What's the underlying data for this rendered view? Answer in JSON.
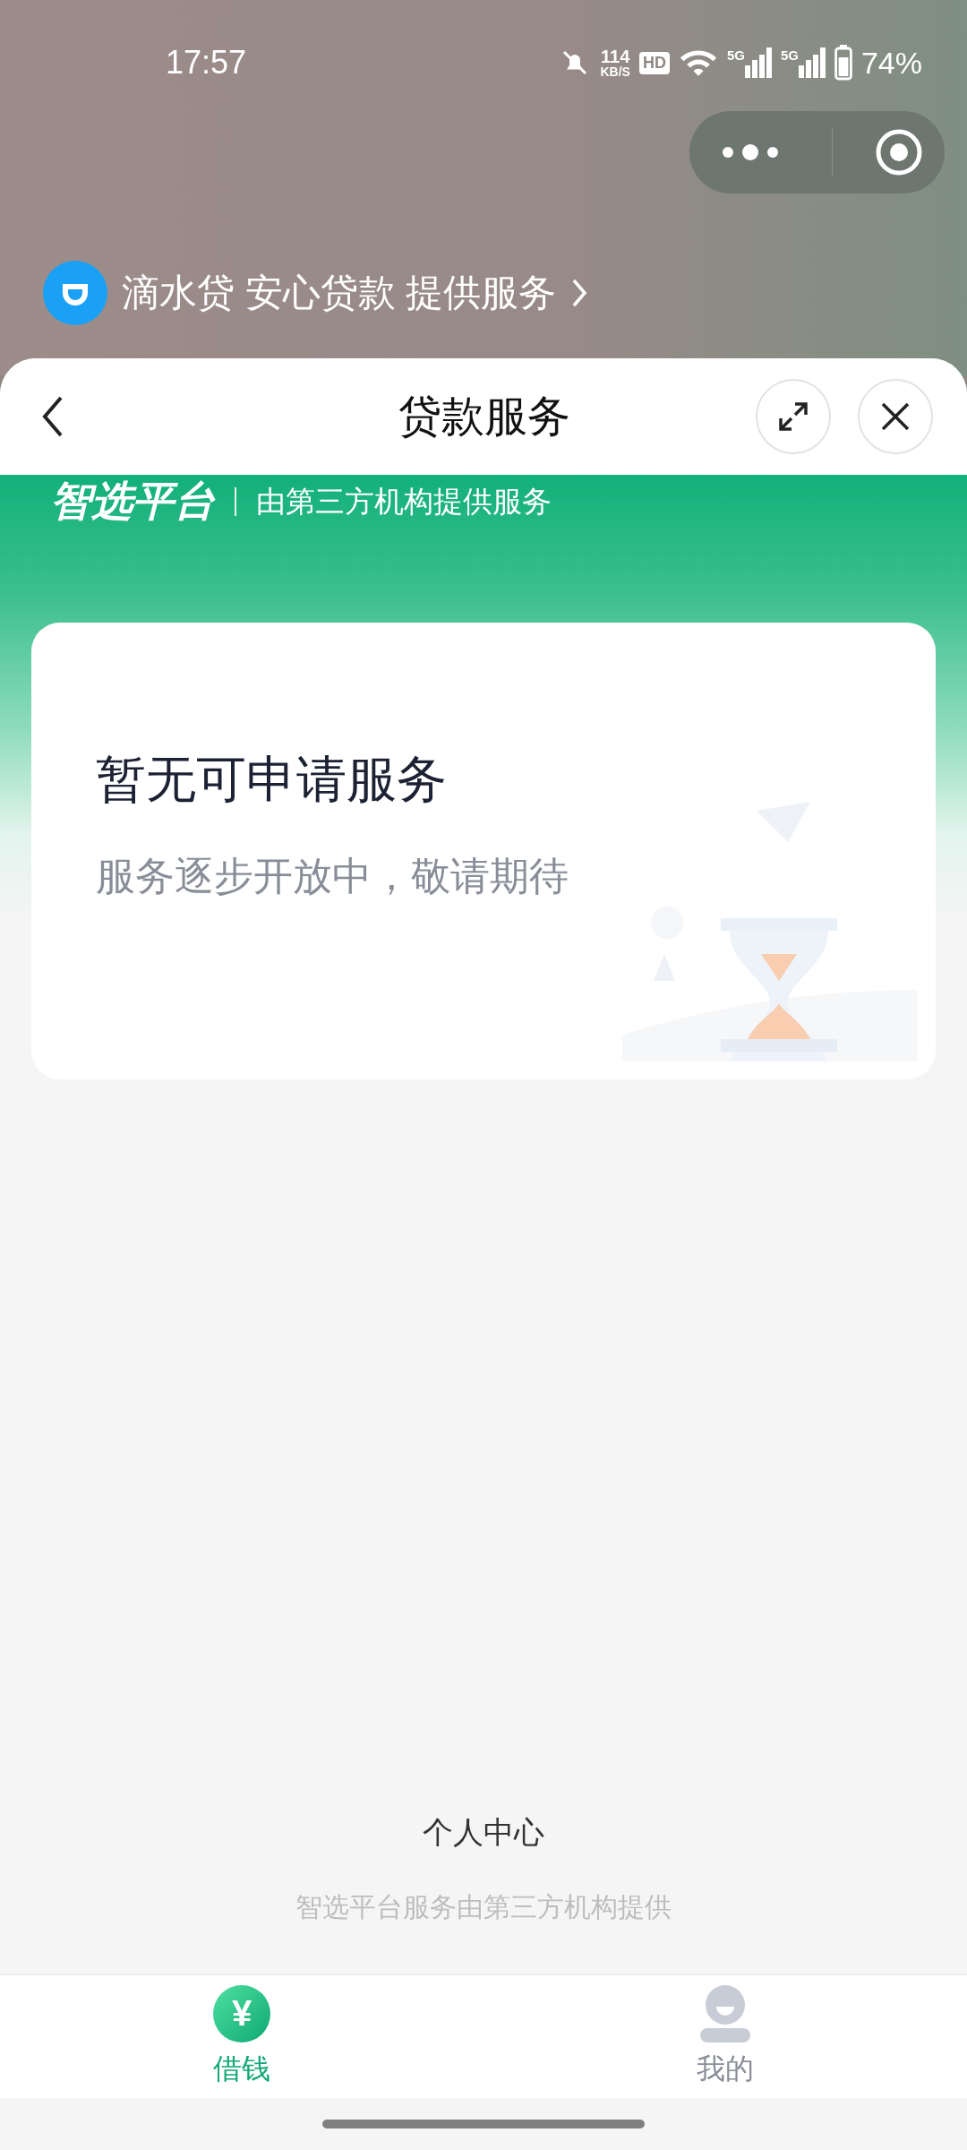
{
  "status_bar": {
    "time": "17:57",
    "net_speed": "114",
    "net_unit": "KB/S",
    "hd": "HD",
    "signals": [
      "5G",
      "5G"
    ],
    "battery": "74%"
  },
  "provider_banner": {
    "text": "滴水贷 安心贷款 提供服务"
  },
  "sheet": {
    "title": "贷款服务"
  },
  "platform": {
    "brand": "智选平台",
    "tagline": "由第三方机构提供服务"
  },
  "empty_state": {
    "title": "暂无可申请服务",
    "subtitle": "服务逐步开放中，敬请期待"
  },
  "footer": {
    "link": "个人中心",
    "note": "智选平台服务由第三方机构提供"
  },
  "tabs": [
    {
      "kind": "loan",
      "icon_char": "¥",
      "label": "借钱",
      "selected": true
    },
    {
      "kind": "profile",
      "label": "我的",
      "selected": false
    }
  ]
}
